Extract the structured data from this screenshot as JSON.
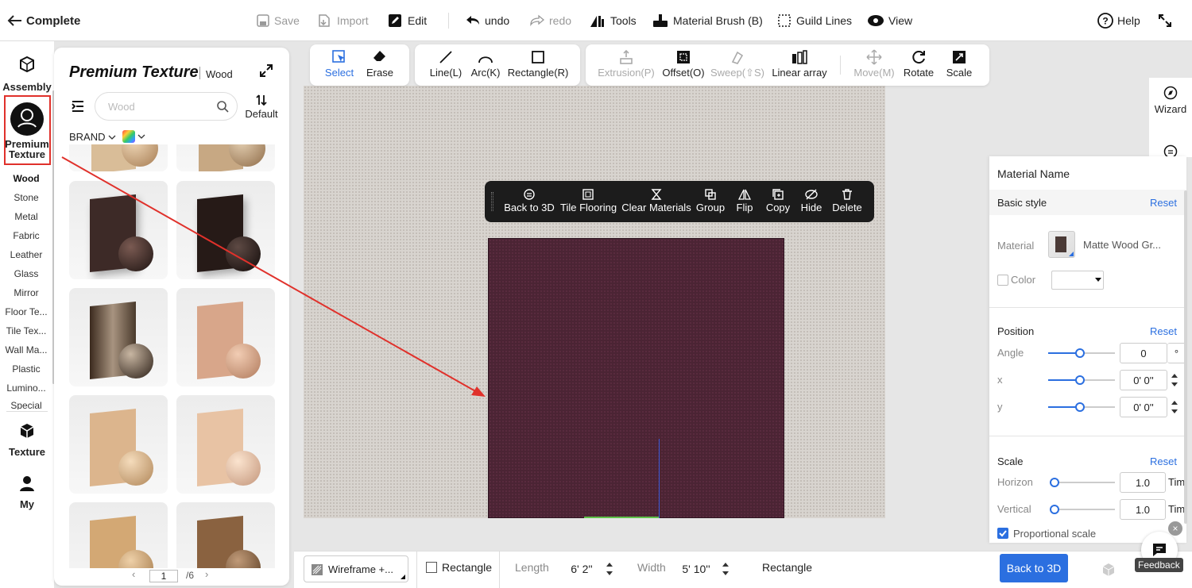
{
  "topbar": {
    "back_label": "Complete",
    "save": "Save",
    "import": "Import",
    "edit": "Edit",
    "undo": "undo",
    "redo": "redo",
    "tools": "Tools",
    "material_brush": "Material Brush (B)",
    "guild_lines": "Guild Lines",
    "view": "View",
    "help": "Help"
  },
  "rail": {
    "assembly": "Assembly",
    "premium_line1": "Premium",
    "premium_line2": "Texture",
    "categories": [
      "Wood",
      "Stone",
      "Metal",
      "Fabric",
      "Leather",
      "Glass",
      "Mirror",
      "Floor Te...",
      "Tile Tex...",
      "Wall Ma...",
      "Plastic",
      "Lumino...",
      "Special"
    ],
    "texture": "Texture",
    "my": "My"
  },
  "texpanel": {
    "title": "Premium Texture",
    "subtitle": "Wood",
    "search_placeholder": "Wood",
    "sort_label": "Default",
    "brand_label": "BRAND",
    "page_current": "1",
    "page_total": "/6",
    "colors": {
      "dark_wood": "#3a2a26",
      "walnut": "#2b1e1a",
      "gloss": "#4a3a2c",
      "cherry": "#d8a68a",
      "light_oak": "#dcb58d",
      "pale": "#e8c3a4",
      "honey": "#d3a874",
      "medium": "#8a6240"
    }
  },
  "drawtools": {
    "select": "Select",
    "erase": "Erase",
    "line": "Line(L)",
    "arc": "Arc(K)",
    "rectangle": "Rectangle(R)",
    "extrusion": "Extrusion(P)",
    "offset": "Offset(O)",
    "sweep": "Sweep(⇧S)",
    "linear_array": "Linear array",
    "move": "Move(M)",
    "rotate": "Rotate",
    "scale": "Scale"
  },
  "ctxbar": {
    "back_to_3d": "Back to 3D",
    "tile_flooring": "Tile Flooring",
    "clear_materials": "Clear Materials",
    "group": "Group",
    "flip": "Flip",
    "copy": "Copy",
    "hide": "Hide",
    "delete": "Delete"
  },
  "rightside": {
    "wizard": "Wizard"
  },
  "rightpanel": {
    "material_name": "Material Name",
    "basic_style": "Basic style",
    "reset": "Reset",
    "material_label": "Material",
    "material_value": "Matte Wood Gr...",
    "color_label": "Color",
    "position": "Position",
    "angle_label": "Angle",
    "angle_value": "0",
    "angle_unit": "°",
    "x_label": "x",
    "x_value": "0' 0''",
    "y_label": "y",
    "y_value": "0' 0''",
    "scale": "Scale",
    "horizon_label": "Horizon",
    "horizon_value": "1.0",
    "vertical_label": "Vertical",
    "vertical_value": "1.0",
    "times_unit": "Time",
    "proportional": "Proportional scale"
  },
  "bottombar": {
    "wireframe": "Wireframe +...",
    "rectangle_toggle": "Rectangle",
    "length_label": "Length",
    "length_value": "6' 2''",
    "width_label": "Width",
    "width_value": "5' 10''",
    "shape_name": "Rectangle",
    "back_to_3d": "Back to 3D",
    "feedback": "Feedback"
  }
}
